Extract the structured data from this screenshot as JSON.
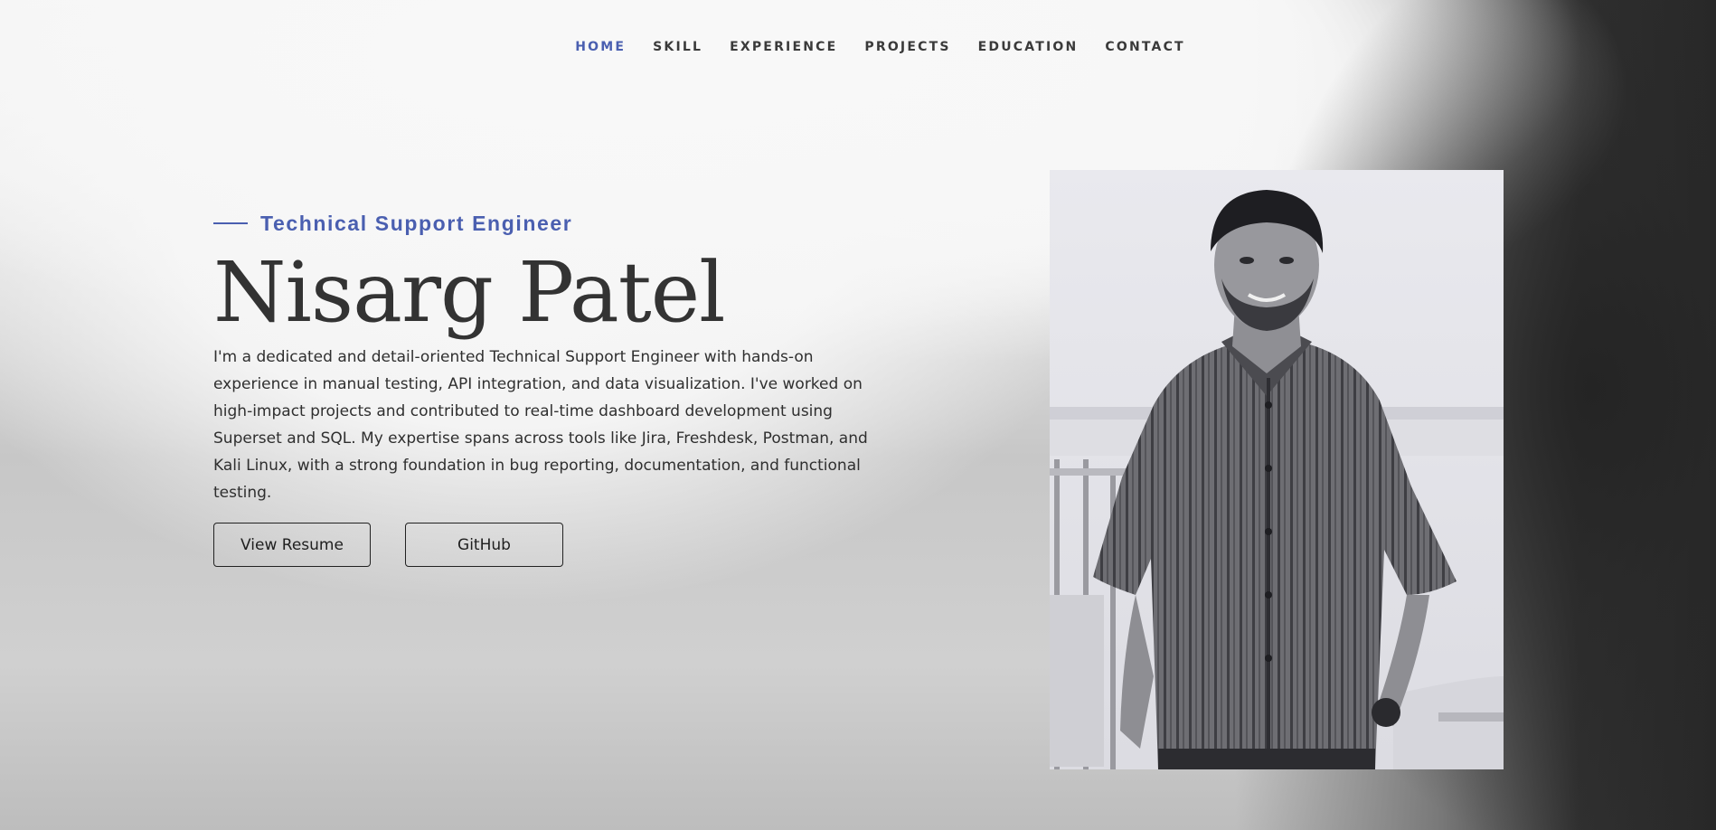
{
  "nav": {
    "items": [
      {
        "label": "HOME",
        "active": true
      },
      {
        "label": "SKILL",
        "active": false
      },
      {
        "label": "EXPERIENCE",
        "active": false
      },
      {
        "label": "PROJECTS",
        "active": false
      },
      {
        "label": "EDUCATION",
        "active": false
      },
      {
        "label": "CONTACT",
        "active": false
      }
    ],
    "active_color": "#4a5fb0"
  },
  "hero": {
    "subtitle": "Technical Support Engineer",
    "name": "Nisarg Patel",
    "bio": "I'm a dedicated and detail-oriented Technical Support Engineer with hands-on experience in manual testing, API integration, and data visualization. I've worked on high-impact projects and contributed to real-time dashboard development using Superset and SQL. My expertise spans across tools like Jira, Freshdesk, Postman, and Kali Linux, with a strong foundation in bug reporting, documentation, and functional testing.",
    "buttons": {
      "resume": "View Resume",
      "github": "GitHub"
    }
  },
  "photo": {
    "subject": "portrait photo of a man in striped shirt",
    "style": "grayscale"
  },
  "colors": {
    "accent": "#4a5fb0",
    "text": "#333333"
  }
}
